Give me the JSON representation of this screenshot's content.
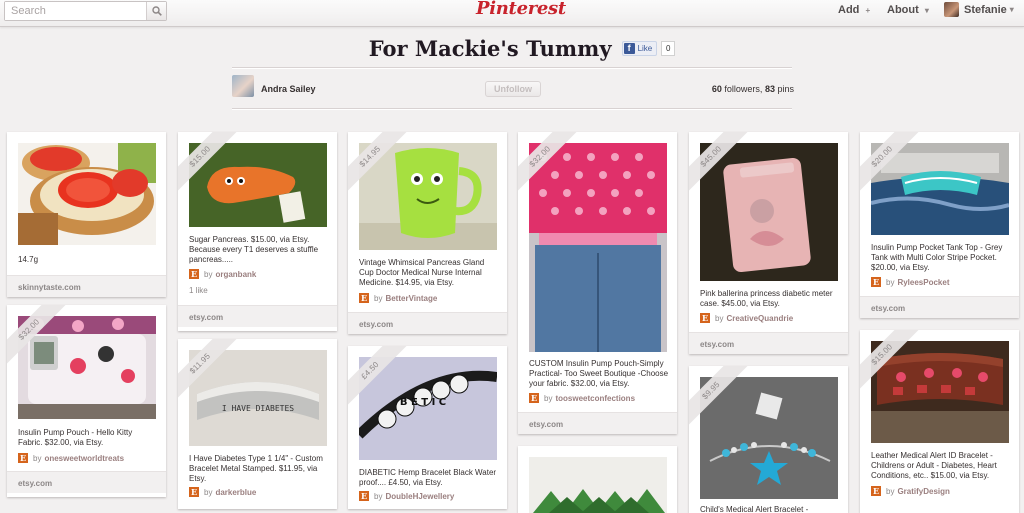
{
  "topbar": {
    "search_placeholder": "Search",
    "logo": "Pinterest",
    "nav_add": "Add",
    "nav_add_suffix": "+",
    "nav_about": "About",
    "nav_caret": "▾",
    "user_name": "Stefanie"
  },
  "board": {
    "title": "For Mackie's Tummy",
    "like_label": "Like",
    "like_count": "0",
    "owner_name": "Andra Sailey",
    "unfollow_label": "Unfollow",
    "followers_count": "60",
    "followers_label": "followers,",
    "pins_count": "83",
    "pins_label": "pins"
  },
  "pins": {
    "p1": {
      "description": "14.7g",
      "footer": "skinnytaste.com"
    },
    "p2": {
      "price": "$15.00",
      "description": "Sugar Pancreas. $15.00, via Etsy. Because every T1 deserves a stuffle pancreas.....",
      "via_prefix": "by",
      "via_user": "organbank",
      "likes": "1 like",
      "footer": "etsy.com"
    },
    "p3": {
      "price": "$14.95",
      "description": "Vintage Whimsical Pancreas Gland Cup Doctor Medical Nurse Internal Medicine. $14.95, via Etsy.",
      "via_prefix": "by",
      "via_user": "BetterVintage",
      "footer": "etsy.com"
    },
    "p4": {
      "price": "$32.00",
      "description": "CUSTOM Insulin Pump Pouch-Simply Practical- Too Sweet Boutique -Choose your fabric. $32.00, via Etsy.",
      "via_prefix": "by",
      "via_user": "toosweetconfections",
      "footer": "etsy.com"
    },
    "p5": {
      "price": "$45.00",
      "description": "Pink ballerina princess diabetic meter case. $45.00, via Etsy.",
      "via_prefix": "by",
      "via_user": "CreativeQuandrie",
      "footer": "etsy.com"
    },
    "p6": {
      "price": "$20.00",
      "description": "Insulin Pump Pocket Tank Top - Grey Tank with Multi Color Stripe Pocket. $20.00, via Etsy.",
      "via_prefix": "by",
      "via_user": "RyleesPocket",
      "footer": "etsy.com"
    },
    "p7": {
      "price": "$32.00",
      "description": "Insulin Pump Pouch - Hello Kitty Fabric. $32.00, via Etsy.",
      "via_prefix": "by",
      "via_user": "onesweetworldtreats",
      "footer": "etsy.com"
    },
    "p8": {
      "price": "$11.95",
      "description": "I Have Diabetes Type 1 1/4\" - Custom Bracelet Metal Stamped. $11.95, via Etsy.",
      "via_prefix": "by",
      "via_user": "darkerblue",
      "stamp_text": "I HAVE DIABETES"
    },
    "p9": {
      "price": "£4.50",
      "description": "DIABETIC Hemp Bracelet Black Water proof.... £4.50, via Etsy.",
      "via_prefix": "by",
      "via_user": "DoubleHJewellery",
      "beads": "B E T I C"
    },
    "p10": {
      "price": "$9.95",
      "description": "Child's Medical Alert Bracelet -"
    },
    "p11": {
      "price": "$15.00",
      "description": "Leather Medical Alert ID Bracelet - Childrens or Adult - Diabetes, Heart Conditions, etc.. $15.00, via Etsy.",
      "via_prefix": "by",
      "via_user": "GratifyDesign"
    }
  },
  "icons": {
    "search": "search-icon",
    "via_badge_letter": "E"
  },
  "colors": {
    "brand_red": "#c8232c",
    "background": "#f2f0f0",
    "etsy_orange": "#d5641c",
    "facebook_blue": "#3b5998"
  }
}
